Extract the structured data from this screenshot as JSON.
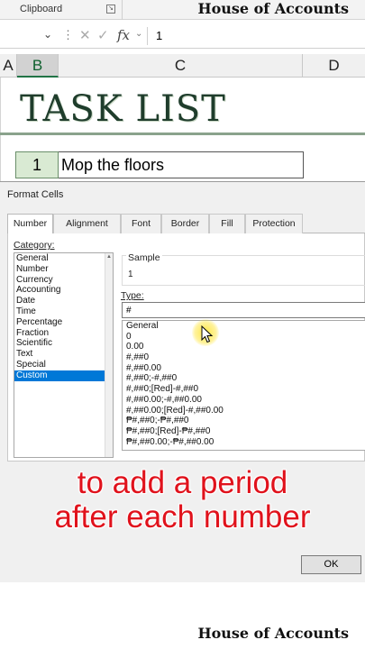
{
  "ribbon": {
    "group_label": "Clipboard"
  },
  "watermark": {
    "text": "House of Accounts"
  },
  "formula_bar": {
    "value": "1",
    "fx_label": "fx"
  },
  "columns": [
    "A",
    "B",
    "C",
    "D"
  ],
  "sheet": {
    "title": "TASK LIST",
    "row": {
      "number": "1",
      "task": "Mop the floors"
    }
  },
  "dialog": {
    "title": "Format Cells",
    "tabs": [
      "Number",
      "Alignment",
      "Font",
      "Border",
      "Fill",
      "Protection"
    ],
    "active_tab": "Number",
    "category_label": "Category:",
    "categories": [
      "General",
      "Number",
      "Currency",
      "Accounting",
      "Date",
      "Time",
      "Percentage",
      "Fraction",
      "Scientific",
      "Text",
      "Special",
      "Custom"
    ],
    "selected_category": "Custom",
    "sample_label": "Sample",
    "sample_value": "1",
    "type_label": "Type:",
    "type_value": "#",
    "type_formats": [
      "General",
      "0",
      "0.00",
      "#,##0",
      "#,##0.00",
      "#,##0;-#,##0",
      "#,##0;[Red]-#,##0",
      "#,##0.00;-#,##0.00",
      "#,##0.00;[Red]-#,##0.00",
      "₱#,##0;-₱#,##0",
      "₱#,##0;[Red]-₱#,##0",
      "₱#,##0.00;-₱#,##0.00"
    ],
    "ok_label": "OK"
  },
  "caption": {
    "line1": "to add a period",
    "line2": "after each number"
  },
  "colors": {
    "selection": "#0078d7",
    "caption": "#e0121c",
    "title": "#1f3d2c"
  },
  "icons": {
    "cancel": "cross-icon",
    "enter": "check-icon",
    "cursor": "mouse-pointer-icon"
  }
}
